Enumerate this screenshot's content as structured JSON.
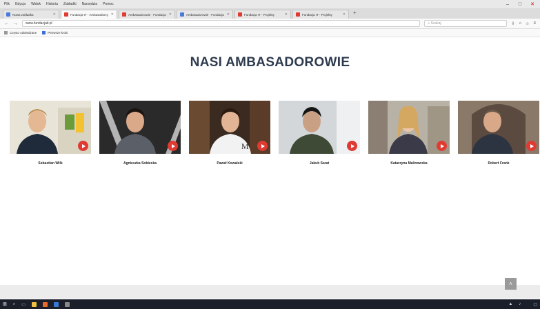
{
  "browser": {
    "menubar": [
      "Plik",
      "Edycja",
      "Widok",
      "Historia",
      "Zakładki",
      "Narzędzia",
      "Pomoc"
    ],
    "tabs": [
      {
        "label": "Nowa zakładka",
        "color": "#4a7bd8",
        "active": false
      },
      {
        "label": "Fundacja IT - Ambasadorzy",
        "color": "#e03b33",
        "active": true
      },
      {
        "label": "Ambasadorowie - Fundacja",
        "color": "#e03b33",
        "active": false
      },
      {
        "label": "Ambasadorowie - Fundacja",
        "color": "#4a7bd8",
        "active": false
      },
      {
        "label": "Fundacja IT - Projekty",
        "color": "#e03b33",
        "active": false
      },
      {
        "label": "Fundacja IT - Projekty",
        "color": "#e03b33",
        "active": false
      }
    ],
    "url": "www.fundacjait.pl",
    "search_placeholder": "Szukaj",
    "bookmarks": [
      "Często odwiedzane",
      "Pierwsze kroki"
    ]
  },
  "page": {
    "heading": "NASI AMBASADOROWIE"
  },
  "ambassadors": [
    {
      "name": "Sebastian Wilk",
      "sub": "",
      "desc": ""
    },
    {
      "name": "Agnieszka Sobieska",
      "sub": "",
      "desc": ""
    },
    {
      "name": "Paweł Kowalski",
      "sub": "",
      "desc": ""
    },
    {
      "name": "Jakub Sarat",
      "sub": "",
      "desc": ""
    },
    {
      "name": "Katarzyna Malinowska",
      "sub": "",
      "desc": ""
    },
    {
      "name": "Robert Frank",
      "sub": "",
      "desc": ""
    }
  ],
  "scroll_top_icon": "chevron-up-icon",
  "taskbar": {
    "clock_time": "",
    "clock_date": ""
  },
  "colors": {
    "heading": "#2e3b4e",
    "play": "#e03b33"
  }
}
